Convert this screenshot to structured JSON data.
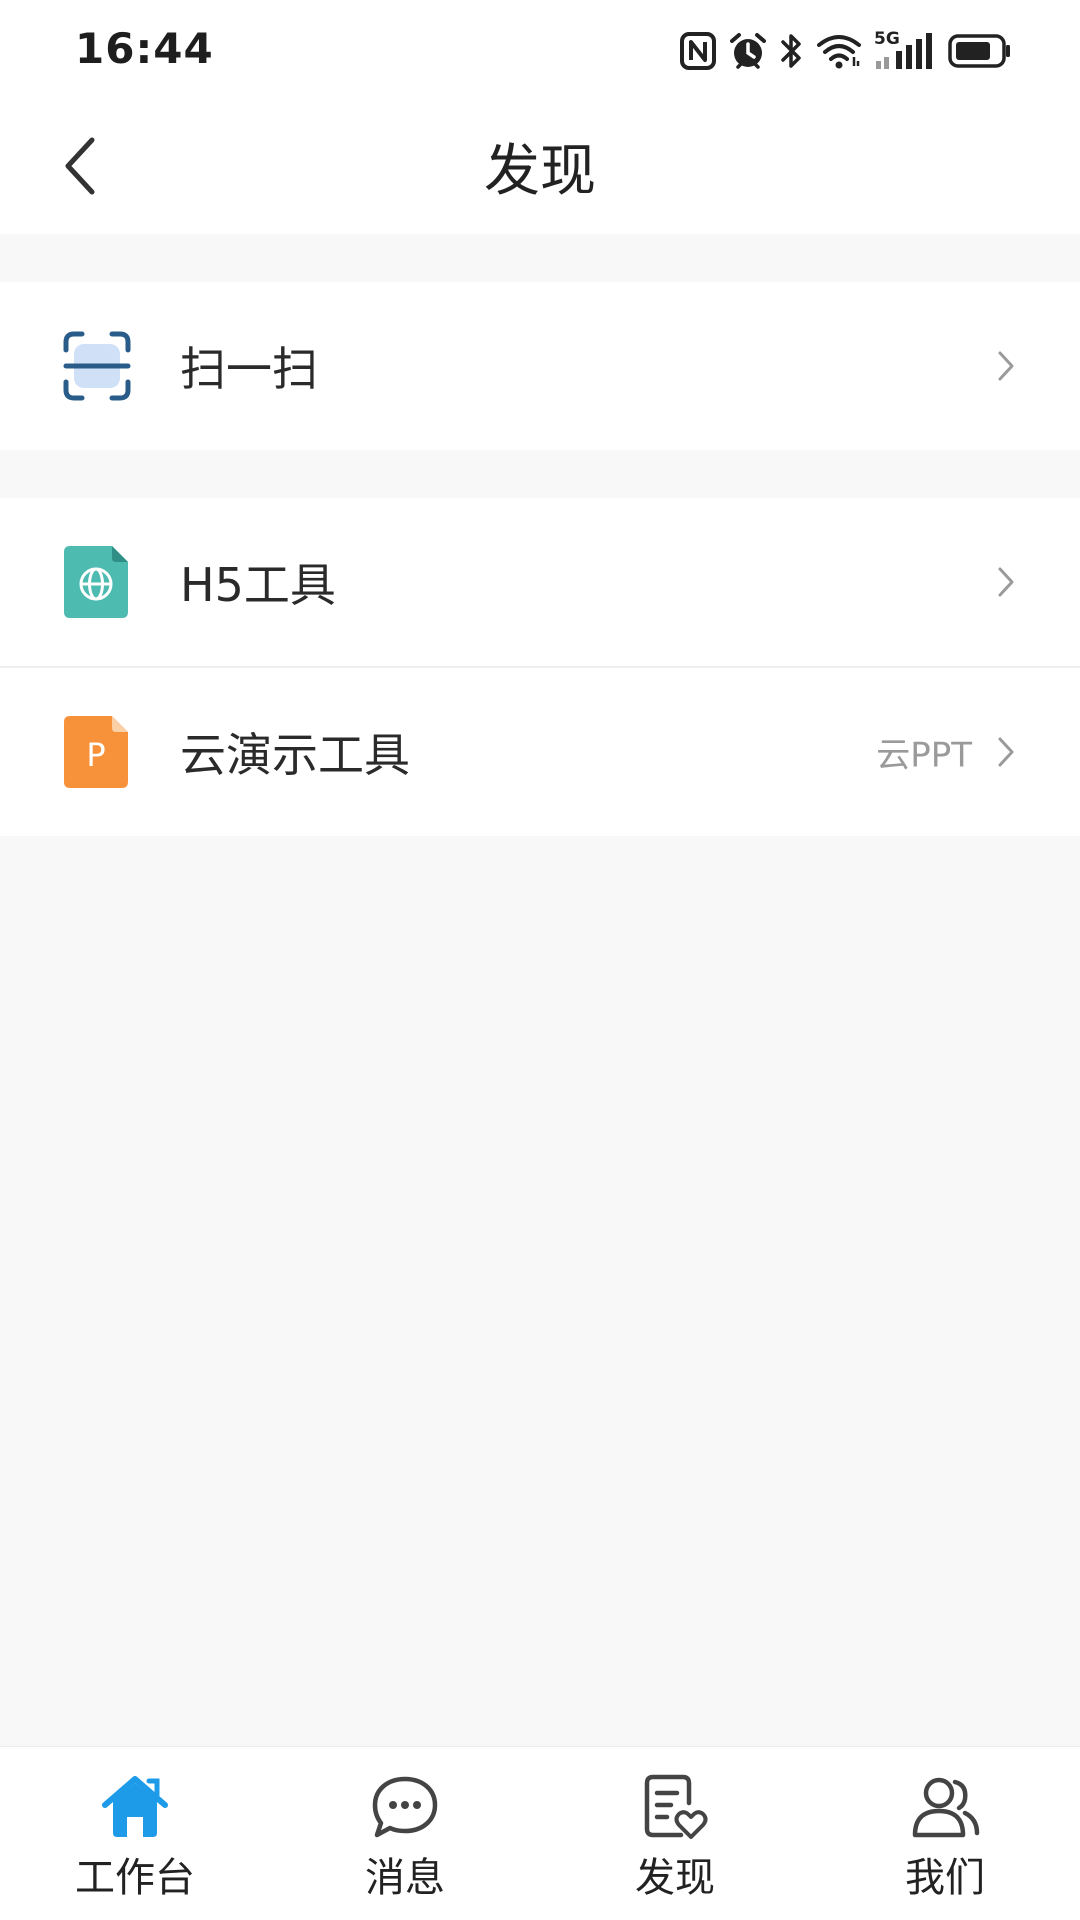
{
  "status_bar": {
    "time": "16:44",
    "icons": [
      "nfc-icon",
      "alarm-icon",
      "bluetooth-icon",
      "wifi-icon",
      "signal-5g-icon",
      "battery-icon"
    ],
    "network_label": "5G"
  },
  "header": {
    "title": "发现",
    "back_icon": "chevron-left-icon"
  },
  "menu_groups": [
    {
      "items": [
        {
          "label": "扫一扫",
          "icon": "scan-icon",
          "extra": ""
        }
      ]
    },
    {
      "items": [
        {
          "label": "H5工具",
          "icon": "h5-globe-file-icon",
          "extra": ""
        },
        {
          "label": "云演示工具",
          "icon": "ppt-file-icon",
          "icon_letter": "P",
          "extra": "云PPT"
        }
      ]
    }
  ],
  "bottom_nav": {
    "active_index": 0,
    "items": [
      {
        "label": "工作台",
        "icon": "home-icon"
      },
      {
        "label": "消息",
        "icon": "chat-bubble-icon"
      },
      {
        "label": "发现",
        "icon": "discover-note-heart-icon"
      },
      {
        "label": "我们",
        "icon": "people-icon"
      }
    ]
  },
  "colors": {
    "accent": "#1e9be8",
    "h5_icon": "#4dbbb0",
    "ppt_icon": "#f7923a",
    "scan_icon": "#2a5c8a",
    "scan_fill": "#cfe0f7",
    "background": "#f8f8f8"
  }
}
